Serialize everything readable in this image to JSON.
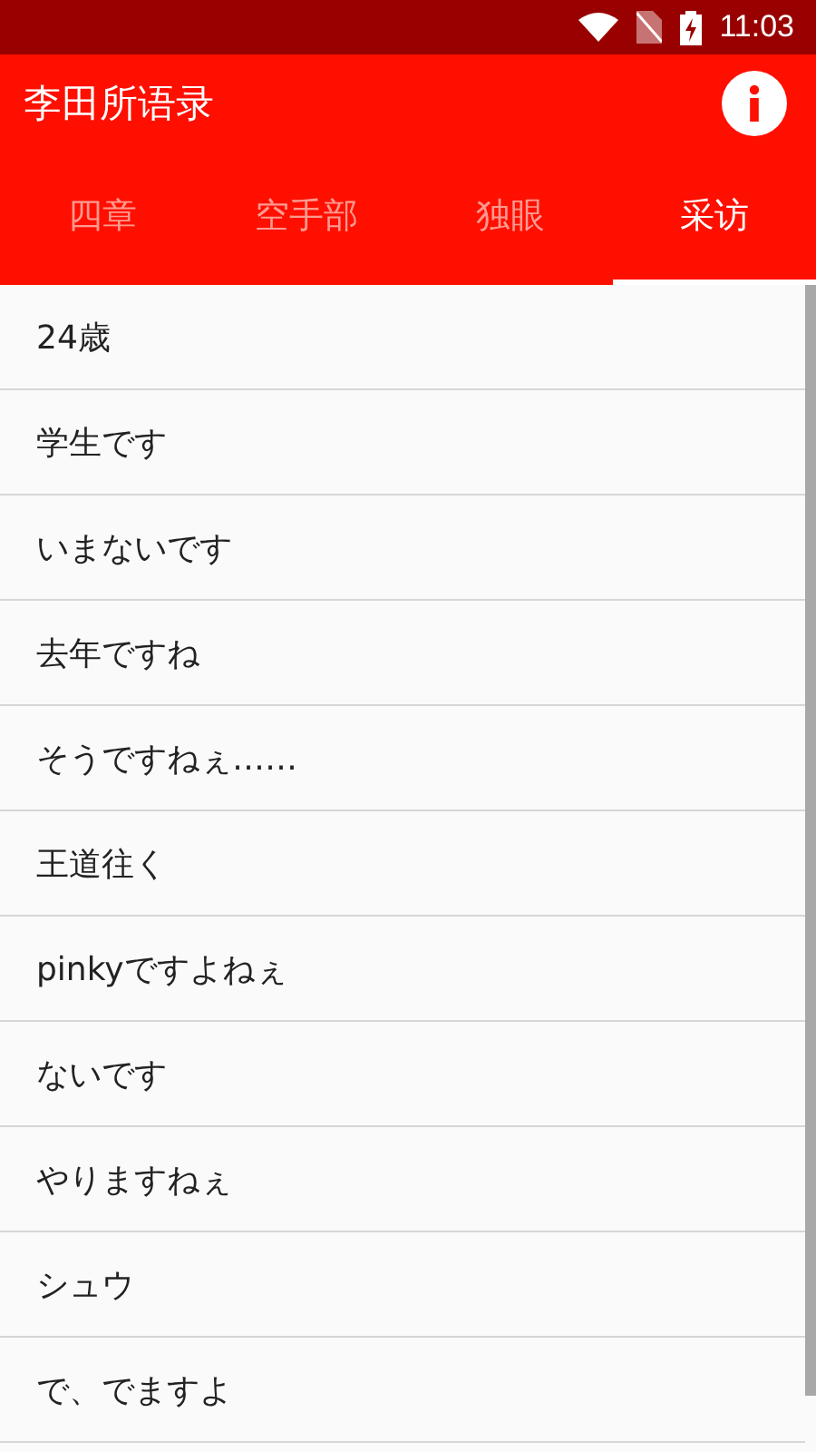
{
  "status_bar": {
    "time": "11:03"
  },
  "app_bar": {
    "title": "李田所语录"
  },
  "tabs": [
    {
      "label": "四章",
      "selected": false
    },
    {
      "label": "空手部",
      "selected": false
    },
    {
      "label": "独眼",
      "selected": false
    },
    {
      "label": "采访",
      "selected": true
    }
  ],
  "list": {
    "items": [
      "24歳",
      "学生です",
      "いまないです",
      "去年ですね",
      "そうですねぇ……",
      "王道往く",
      "pinkyですよねぇ",
      "ないです",
      "やりますねぇ",
      "シュウ",
      "で、でますよ"
    ]
  }
}
